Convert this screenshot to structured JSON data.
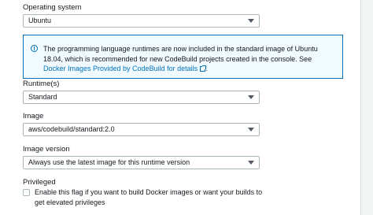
{
  "os": {
    "label": "Operating system",
    "value": "Ubuntu"
  },
  "info": {
    "text": "The programming language runtimes are now included in the standard image of Ubuntu 18.04, which is recommended for new CodeBuild projects created in the console. See ",
    "link": "Docker Images Provided by CodeBuild for details",
    "end": "."
  },
  "runtime": {
    "label": "Runtime(s)",
    "value": "Standard"
  },
  "image": {
    "label": "Image",
    "value": "aws/codebuild/standard:2.0"
  },
  "image_version": {
    "label": "Image version",
    "value": "Always use the latest image for this runtime version"
  },
  "privileged": {
    "label": "Privileged",
    "checkbox_label": "Enable this flag if you want to build Docker images or want your builds to get elevated privileges",
    "checked": false
  },
  "icons": {
    "info": "info-icon",
    "external_link": "external-link-icon",
    "dropdown": "caret-down-icon"
  },
  "colors": {
    "accent": "#0073bb",
    "info_background": "#f1faff",
    "border": "#aab7b8",
    "text": "#16191f"
  }
}
